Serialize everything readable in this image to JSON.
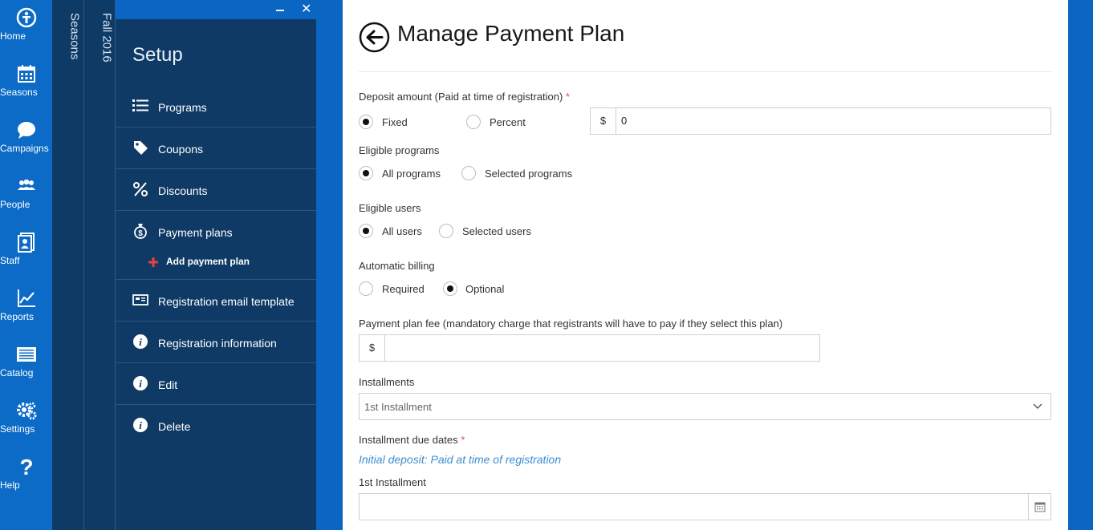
{
  "rail": {
    "items": [
      {
        "label": "Home",
        "icon": "home-icon"
      },
      {
        "label": "Seasons",
        "icon": "calendar-icon"
      },
      {
        "label": "Campaigns",
        "icon": "chat-icon"
      },
      {
        "label": "People",
        "icon": "people-icon"
      },
      {
        "label": "Staff",
        "icon": "staff-icon"
      },
      {
        "label": "Reports",
        "icon": "chart-icon"
      },
      {
        "label": "Catalog",
        "icon": "catalog-icon"
      },
      {
        "label": "Settings",
        "icon": "gear-icon"
      },
      {
        "label": "Help",
        "icon": "help-icon"
      }
    ]
  },
  "panels": {
    "seasons_label": "Seasons",
    "season_name": "Fall 2016"
  },
  "setup": {
    "title": "Setup",
    "minimize_label": "‒",
    "close_label": "✕",
    "menu": [
      {
        "label": "Programs",
        "icon": "list-icon"
      },
      {
        "label": "Coupons",
        "icon": "tag-icon"
      },
      {
        "label": "Discounts",
        "icon": "percent-icon"
      },
      {
        "label": "Payment plans",
        "icon": "money-bag-icon"
      },
      {
        "label": "Registration email template",
        "icon": "email-template-icon"
      },
      {
        "label": "Registration information",
        "icon": "info-icon"
      },
      {
        "label": "Edit",
        "icon": "info-icon"
      },
      {
        "label": "Delete",
        "icon": "info-icon"
      }
    ],
    "sub_item": {
      "label": "Add payment plan",
      "icon": "plus-icon"
    }
  },
  "main": {
    "title": "Manage Payment Plan",
    "deposit": {
      "label": "Deposit amount (Paid at time of registration)",
      "required_mark": "*",
      "options": [
        "Fixed",
        "Percent"
      ],
      "selected": "Fixed",
      "currency": "$",
      "value": "0"
    },
    "eligible_programs": {
      "label": "Eligible programs",
      "options": [
        "All programs",
        "Selected programs"
      ],
      "selected": "All programs"
    },
    "eligible_users": {
      "label": "Eligible users",
      "options": [
        "All users",
        "Selected users"
      ],
      "selected": "All users"
    },
    "automatic_billing": {
      "label": "Automatic billing",
      "options": [
        "Required",
        "Optional"
      ],
      "selected": "Optional"
    },
    "fee": {
      "label": "Payment plan fee (mandatory charge that registrants will have to pay if they select this plan)",
      "currency": "$",
      "value": ""
    },
    "installments": {
      "label": "Installments",
      "selected": "1st Installment"
    },
    "due_dates": {
      "label": "Installment due dates",
      "required_mark": "*",
      "note": "Initial deposit: Paid at time of registration",
      "first_label": "1st Installment",
      "first_value": ""
    }
  },
  "colors": {
    "rail": "#0b6bc7",
    "panel": "#0f3a66",
    "accent_link": "#3c8dcf",
    "required": "#d9534f",
    "add_icon": "#e8413a"
  }
}
